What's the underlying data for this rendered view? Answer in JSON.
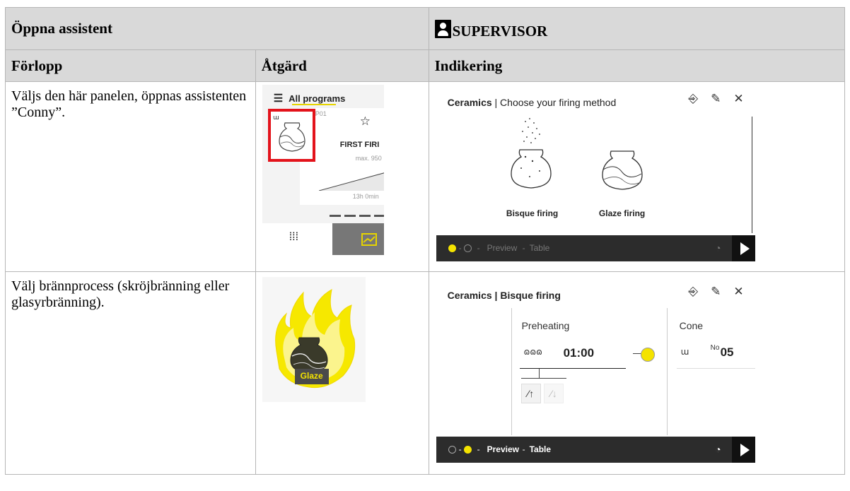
{
  "header": {
    "left_title": "Öppna assistent",
    "right_title": "SUPERVISOR"
  },
  "columns": {
    "progress": "Förlopp",
    "action": "Åtgärd",
    "indication": "Indikering"
  },
  "rows": [
    {
      "description": "Väljs den här panelen, öppnas assistenten ”Conny”."
    },
    {
      "description": "Välj brännprocess (skröjbränning eller glasyrbränning)."
    }
  ],
  "program_list": {
    "title": "All programs",
    "program_number": "P01",
    "program_name": "FIRST FIRI",
    "max_label": "max. 950",
    "duration": "13h 0min"
  },
  "glaze_button": {
    "label": "Glaze"
  },
  "screen1": {
    "title_bold": "Ceramics",
    "title_rest": "| Choose your firing method",
    "option1": "Bisque firing",
    "option2": "Glaze firing",
    "nav_preview": "Preview",
    "nav_table": "Table"
  },
  "screen2": {
    "title": "Ceramics | Bisque firing",
    "preheating_label": "Preheating",
    "preheating_time": "01:00",
    "cone_label": "Cone",
    "cone_prefix": "No",
    "cone_value": "05",
    "nav_preview": "Preview",
    "nav_table": "Table"
  },
  "colors": {
    "highlight_red": "#e3131b",
    "accent_yellow": "#f4e300",
    "header_gray": "#d9d9d9"
  }
}
